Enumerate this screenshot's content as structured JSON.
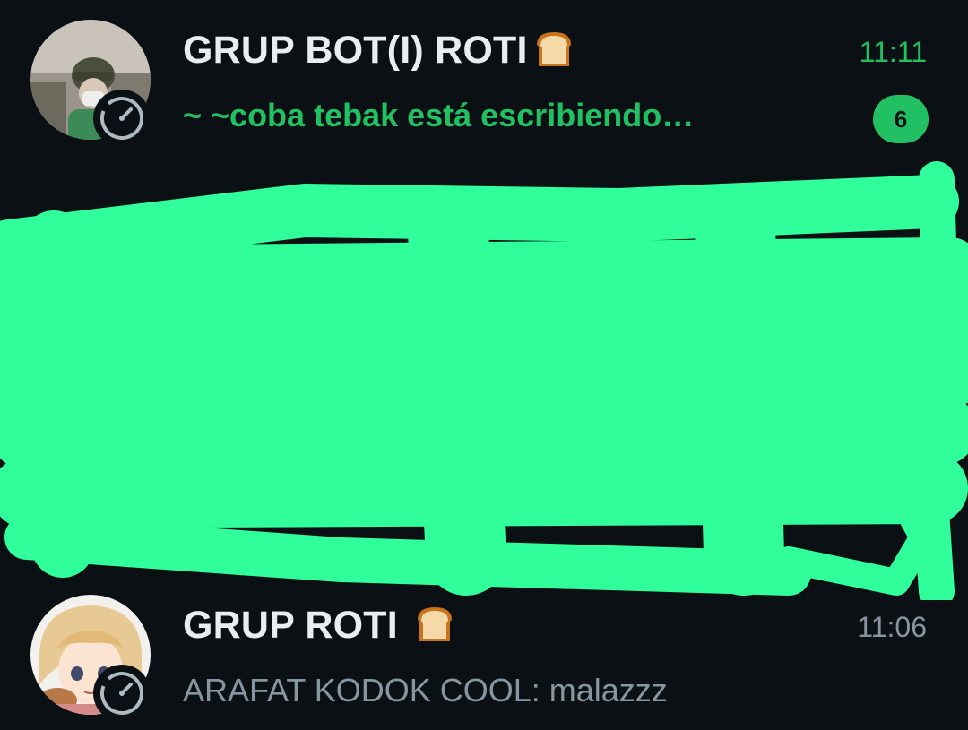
{
  "chats": [
    {
      "name": "GRUP BOT(I) ROTI",
      "name_emoji": "bread-icon",
      "time": "11:11",
      "preview": "~ ~coba tebak está escribiendo…",
      "unread_count": "6",
      "avatar": "avatar-person-helmet",
      "status_icon": "status-ring-icon"
    },
    {
      "name": "GRUP ROTI ",
      "name_emoji": "bread-icon",
      "time": "11:06",
      "preview": "ARAFAT KODOK COOL: malazzz",
      "avatar": "avatar-anime-character",
      "status_icon": "status-ring-icon"
    }
  ],
  "redaction_color": "#2ffe9a",
  "accent_color": "#21c063",
  "background_color": "#0b1014"
}
